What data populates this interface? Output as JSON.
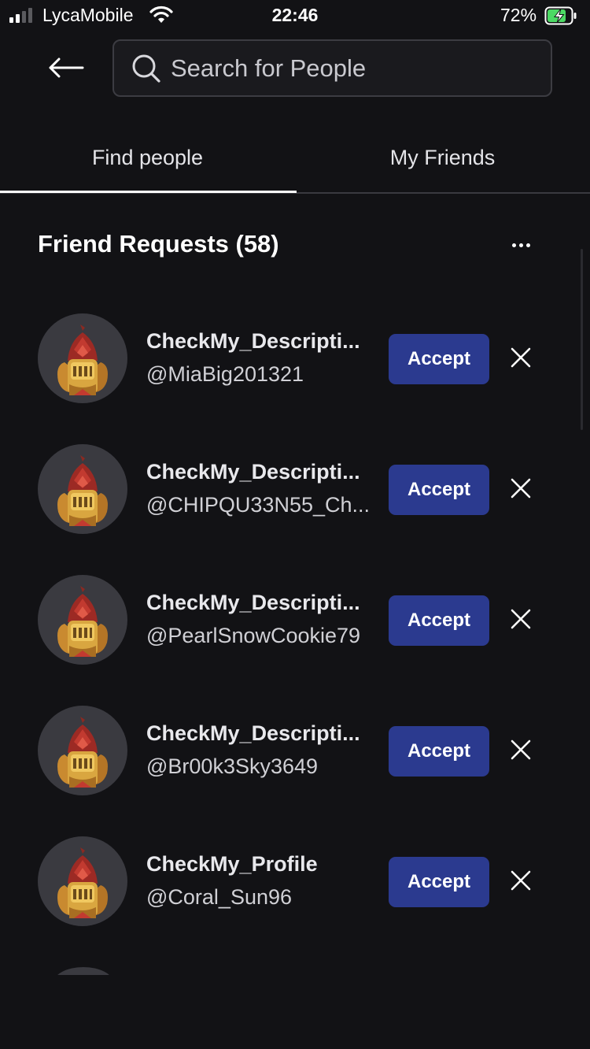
{
  "status_bar": {
    "carrier": "LycaMobile",
    "time": "22:46",
    "battery_percent": "72%",
    "signal_icon": "signal-bars-icon",
    "wifi_icon": "wifi-icon",
    "battery_icon": "battery-charging-icon"
  },
  "header": {
    "back_icon": "arrow-left-icon",
    "search_placeholder": "Search for People",
    "search_value": ""
  },
  "tabs": [
    {
      "label": "Find people",
      "active": true
    },
    {
      "label": "My Friends",
      "active": false
    }
  ],
  "section": {
    "title": "Friend Requests (58)",
    "more_icon": "more-horizontal-icon"
  },
  "requests": [
    {
      "display_name": "CheckMy_Descripti...",
      "username": "@MiaBig201321",
      "accept_label": "Accept"
    },
    {
      "display_name": "CheckMy_Descripti...",
      "username": "@CHIPQU33N55_Ch...",
      "accept_label": "Accept"
    },
    {
      "display_name": "CheckMy_Descripti...",
      "username": "@PearlSnowCookie79",
      "accept_label": "Accept"
    },
    {
      "display_name": "CheckMy_Descripti...",
      "username": "@Br00k3Sky3649",
      "accept_label": "Accept"
    },
    {
      "display_name": "CheckMy_Profile",
      "username": "@Coral_Sun96",
      "accept_label": "Accept"
    }
  ],
  "colors": {
    "background": "#121215",
    "accept_button": "#2b3a8f",
    "avatar_background": "#3a3a40"
  }
}
